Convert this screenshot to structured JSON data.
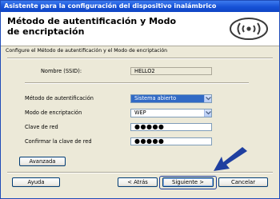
{
  "window": {
    "title": "Asistente para la configuración del dispositivo inalámbrico"
  },
  "header": {
    "title": "Método de autentificación y Modo de encriptación",
    "logo_icon": "wifi-logo-icon"
  },
  "section": {
    "text": "Configure el Método de autentificación y el Modo de encriptación"
  },
  "form": {
    "ssid_label": "Nombre (SSID):",
    "ssid_value": "HELLO2",
    "auth_label": "Método de autentificación",
    "auth_value": "Sistema abierto",
    "enc_label": "Modo de encriptación",
    "enc_value": "WEP",
    "key_label": "Clave de red",
    "key_value": "●●●●●",
    "confirm_label": "Confirmar la clave de red",
    "confirm_value": "●●●●●"
  },
  "buttons": {
    "advanced": "Avanzada",
    "help": "Ayuda",
    "back": "< Atrás",
    "next": "Siguiente >",
    "cancel": "Cancelar"
  },
  "colors": {
    "titlebar": "#1651d6",
    "selection": "#316ac5",
    "pointer_arrow": "#1f3fa0"
  }
}
